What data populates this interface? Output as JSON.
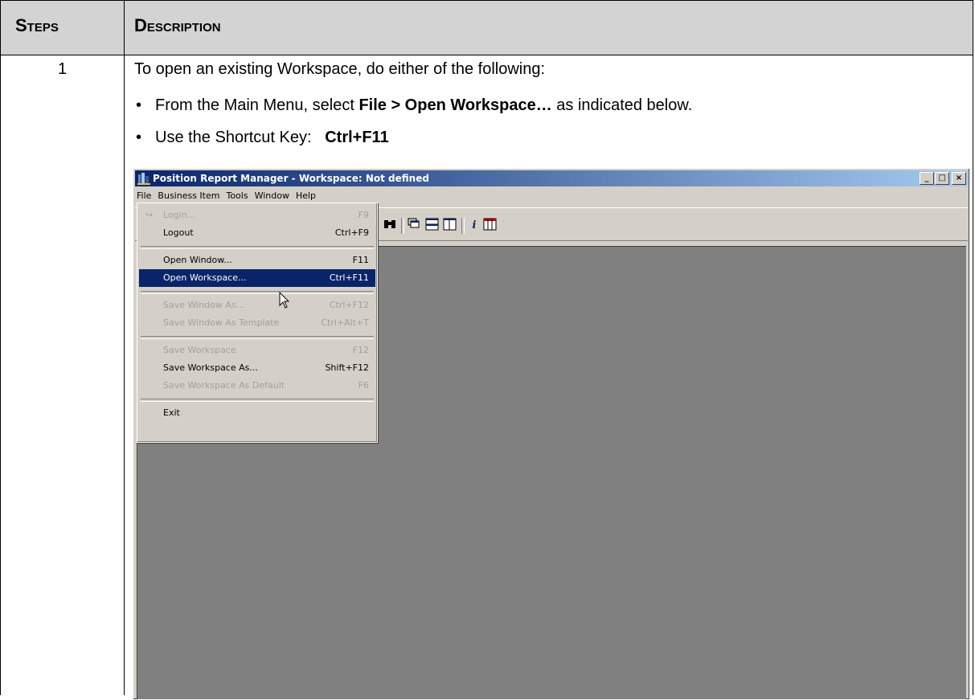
{
  "header": {
    "steps": "Steps",
    "description": "Description"
  },
  "step": {
    "number": "1",
    "intro": "To open an existing Workspace, do either of the following:",
    "bullet1": {
      "pre": "From the Main Menu, select ",
      "bold": "File > Open Workspace…",
      "post": " as indicated below."
    },
    "bullet2": {
      "pre": "Use the Shortcut Key:   ",
      "bold": "Ctrl+F11"
    }
  },
  "app": {
    "title": "Position Report Manager - Workspace: Not defined",
    "window_buttons": {
      "minimize": "_",
      "maximize": "□",
      "close": "×"
    },
    "menubar": [
      "File",
      "Business Item",
      "Tools",
      "Window",
      "Help"
    ],
    "file_menu": [
      {
        "label": "Login...",
        "shortcut": "F9",
        "disabled": true
      },
      {
        "label": "Logout",
        "shortcut": "Ctrl+F9",
        "disabled": false
      },
      {
        "label": "Open Window...",
        "shortcut": "F11",
        "disabled": false
      },
      {
        "label": "Open Workspace...",
        "shortcut": "Ctrl+F11",
        "disabled": false,
        "highlighted": true
      },
      {
        "label": "Save Window As...",
        "shortcut": "Ctrl+F12",
        "disabled": true
      },
      {
        "label": "Save Window As Template",
        "shortcut": "Ctrl+Alt+T",
        "disabled": true
      },
      {
        "label": "Save Workspace",
        "shortcut": "F12",
        "disabled": true
      },
      {
        "label": "Save Workspace As...",
        "shortcut": "Shift+F12",
        "disabled": false
      },
      {
        "label": "Save Workspace As Default",
        "shortcut": "F6",
        "disabled": true
      },
      {
        "label": "Exit",
        "shortcut": "",
        "disabled": false
      }
    ],
    "toolbar_icons": [
      "binoculars-icon",
      "cascade-icon",
      "tile-horizontal-icon",
      "tile-vertical-icon",
      "info-icon",
      "grid-icon"
    ]
  },
  "colors": {
    "header_bg": "#d3d3d3",
    "title_bar": "#0a246a",
    "workspace": "#808080",
    "window_face": "#d4d0c8"
  }
}
